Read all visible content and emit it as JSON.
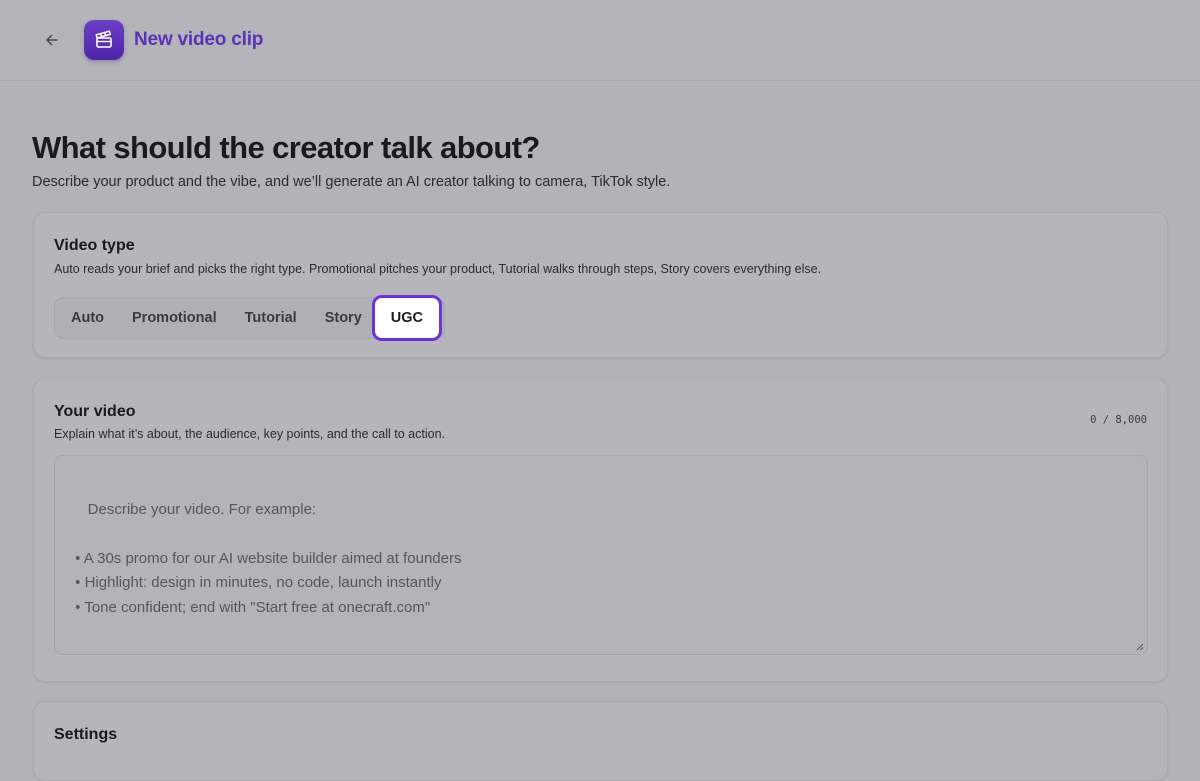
{
  "header": {
    "title": "New video clip",
    "back_icon": "arrow-left-icon",
    "app_icon": "clapperboard-icon",
    "accent_color": "#5a32b6"
  },
  "page": {
    "heading": "What should the creator talk about?",
    "subheading": "Describe your product and the vibe, and we’ll generate an AI creator talking to camera, TikTok style."
  },
  "video_type": {
    "title": "Video type",
    "description": "Auto reads your brief and picks the right type. Promotional pitches your product, Tutorial walks through steps, Story covers everything else.",
    "options": [
      "Auto",
      "Promotional",
      "Tutorial",
      "Story",
      "UGC"
    ],
    "selected": "UGC"
  },
  "your_video": {
    "title": "Your video",
    "description": "Explain what it’s about, the audience, key points, and the call to action.",
    "counter": "0 / 8,000",
    "value": "",
    "placeholder": "Describe your video. For example:\n\n • A 30s promo for our AI website builder aimed at founders\n • Highlight: design in minutes, no code, launch instantly\n • Tone confident; end with \"Start free at onecraft.com\""
  },
  "settings": {
    "title": "Settings"
  }
}
